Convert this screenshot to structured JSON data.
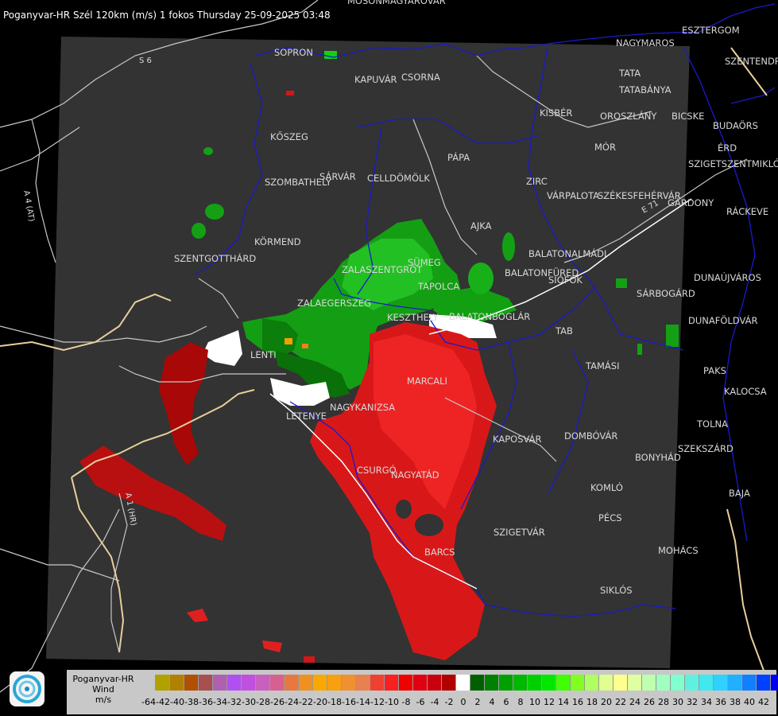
{
  "title": "Poganyvar-HR Szél 120km (m/s) 1 fokos Thursday 25-09-2025 03:48",
  "places": [
    "MOSONMAGYARÓVÁR",
    "ESZTERGOM",
    "NAGYMAROS",
    "SOPRON",
    "KAPUVÁR",
    "CSORNA",
    "TATA",
    "TATABÁNYA",
    "SZENTENDRE",
    "KISBÉR",
    "OROSZLÁNY",
    "BICSKE",
    "BUDAÖRS",
    "KŐSZEG",
    "MÓR",
    "ÉRD",
    "PÁPA",
    "SZIGETSZENTMIKLÓS",
    "SZOMBATHELY",
    "SÁRVÁR",
    "CELLDÖMÖLK",
    "ZIRC",
    "VÁRPALOTA",
    "SZÉKESFEHÉRVÁR",
    "GÁRDONY",
    "RÁCKEVE",
    "AJKA",
    "KÖRMEND",
    "BALATONALMÁDI",
    "SZENTGOTTHÁRD",
    "SÜMEG",
    "ZALAEGERSZEG",
    "TAPOLCA",
    "BALATONFÜRED",
    "SIÓFOK",
    "DUNAÚJVÁROS",
    "KESZTHELY",
    "BALATONBOGLÁR",
    "SÁRBOGÁRD",
    "DUNAFÖLDVÁR",
    "TAB",
    "LENTI",
    "TAMÁSI",
    "PAKS",
    "MARCALI",
    "KALOCSA",
    "LETENYE",
    "NAGYKANIZSA",
    "KAPOSVÁR",
    "DOMBÓVÁR",
    "TOLNA",
    "SZEKSZÁRD",
    "BONYHÁD",
    "CSURGÓ",
    "NAGYATÁD",
    "KOMLÓ",
    "BAJA",
    "PÉCS",
    "SZIGETVÁR",
    "MOHÁCS",
    "BARCS",
    "SIKLÓS",
    "ZALASZENTGRÓT"
  ],
  "roads": [
    "S 6",
    "A 4 (AT)",
    "A 1 (HR)",
    "E 71"
  ],
  "legend": {
    "title_lines": [
      "Poganyvar-HR",
      "Wind",
      "m/s"
    ],
    "colors": [
      "#c8c8c8",
      "#b0a000",
      "#b08000",
      "#b05000",
      "#a85050",
      "#b060b0",
      "#b050f0",
      "#c050e0",
      "#c860c0",
      "#d86090",
      "#e87840",
      "#f09020",
      "#f8a800",
      "#f8a010",
      "#f09030",
      "#e88050",
      "#f04030",
      "#f82020",
      "#f00000",
      "#e00010",
      "#c80010",
      "#b00000",
      "#ffffff",
      "#006000",
      "#008000",
      "#00a000",
      "#00b800",
      "#00d000",
      "#00e800",
      "#40ff00",
      "#80ff20",
      "#b0ff60",
      "#e0ff90",
      "#ffff90",
      "#e0ffa0",
      "#c0ffb0",
      "#a0ffc0",
      "#80ffd0",
      "#60f0e0",
      "#40e8f0",
      "#30d0ff",
      "#20b0ff",
      "#1080ff",
      "#0040ff",
      "#0000f0"
    ],
    "ticks": [
      "-64",
      "-42",
      "-40",
      "-38",
      "-36",
      "-34",
      "-32",
      "-30",
      "-28",
      "-26",
      "-24",
      "-22",
      "-20",
      "-18",
      "-16",
      "-14",
      "-12",
      "-10",
      "-8",
      "-6",
      "-4",
      "-2",
      "0",
      "2",
      "4",
      "6",
      "8",
      "10",
      "12",
      "14",
      "16",
      "18",
      "20",
      "22",
      "24",
      "26",
      "28",
      "30",
      "32",
      "34",
      "36",
      "38",
      "40",
      "42"
    ]
  }
}
